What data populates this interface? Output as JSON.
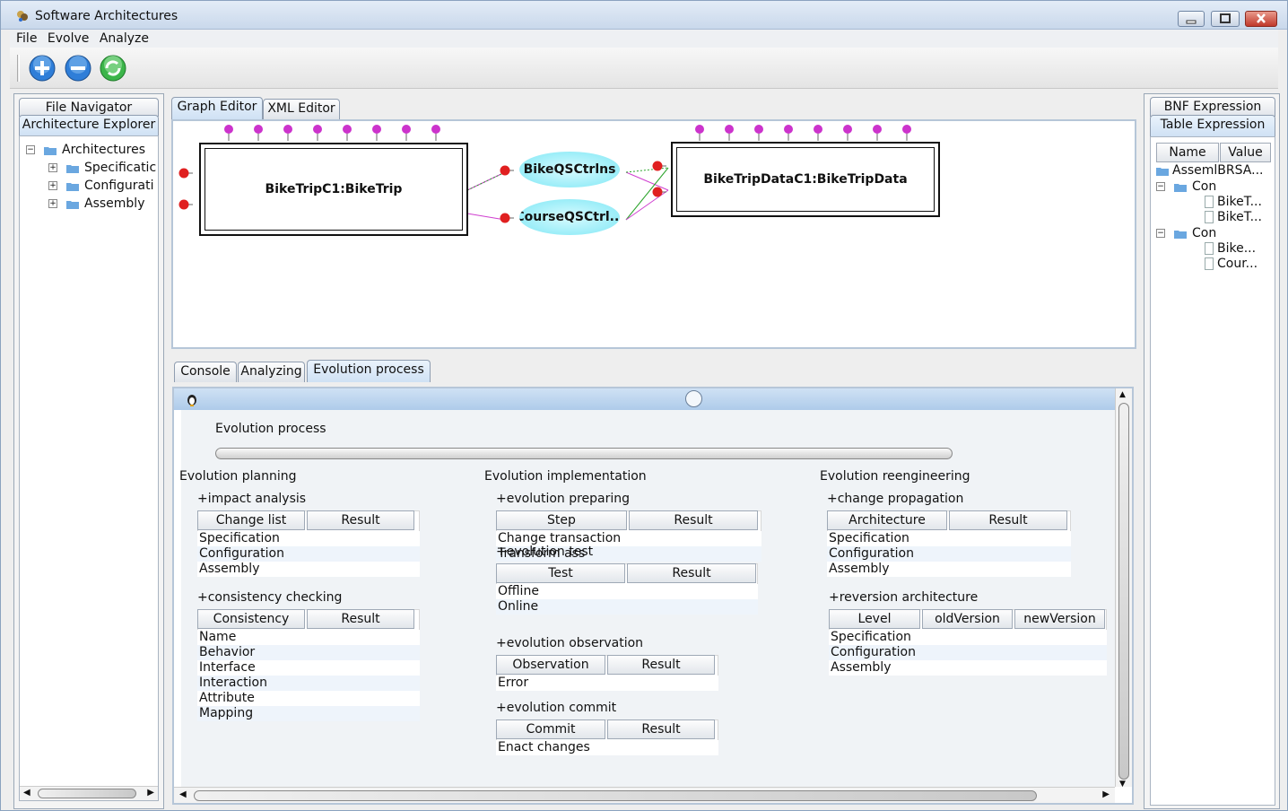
{
  "window": {
    "title": "Software Architectures"
  },
  "menu": {
    "items": [
      "File",
      "Evolve",
      "Analyze"
    ]
  },
  "left": {
    "tabs": [
      "File Navigator",
      "Architecture Explorer"
    ],
    "tree": {
      "root": "Architectures",
      "children": [
        "Specificatic",
        "Configurati",
        "Assembly"
      ]
    }
  },
  "editor": {
    "tabs": [
      "Graph Editor",
      "XML Editor"
    ],
    "components": [
      "BikeTripC1:BikeTrip",
      "BikeTripDataC1:BikeTripData"
    ],
    "connectors": [
      "BikeQSCtrlns",
      "CourseQSCtrl..."
    ]
  },
  "bottom": {
    "tabs": [
      "Console",
      "Analyzing",
      "Evolution process"
    ]
  },
  "evolution": {
    "title": "Evolution process",
    "planning": {
      "title": "Evolution planning",
      "impact": {
        "label": "+impact analysis",
        "headers": [
          "Change list",
          "Result"
        ],
        "rows": [
          "Specification",
          "Configuration",
          "Assembly"
        ]
      },
      "consistency": {
        "label": "+consistency checking",
        "headers": [
          "Consistency",
          "Result"
        ],
        "rows": [
          "Name",
          "Behavior",
          "Interface",
          "Interaction",
          "Attribute",
          "Mapping"
        ]
      }
    },
    "implementation": {
      "title": "Evolution implementation",
      "preparing": {
        "label": "+evolution preparing",
        "headers": [
          "Step",
          "Result"
        ],
        "rows": [
          "Change transaction",
          "Transform ass"
        ]
      },
      "test": {
        "label": "+evolution test",
        "headers": [
          "Test",
          "Result"
        ],
        "rows": [
          "Offline",
          "Online"
        ]
      },
      "observation": {
        "label": "+evolution observation",
        "headers": [
          "Observation",
          "Result"
        ],
        "rows": [
          "Error"
        ]
      },
      "commit": {
        "label": "+evolution commit",
        "headers": [
          "Commit",
          "Result"
        ],
        "rows": [
          "Enact changes"
        ]
      }
    },
    "reengineering": {
      "title": "Evolution reengineering",
      "propagation": {
        "label": "+change propagation",
        "headers": [
          "Architecture",
          "Result"
        ],
        "rows": [
          "Specification",
          "Configuration",
          "Assembly"
        ]
      },
      "reversion": {
        "label": "+reversion architecture",
        "headers": [
          "Level",
          "oldVersion",
          "newVersion"
        ],
        "rows": [
          "Specification",
          "Configuration",
          "Assembly"
        ]
      }
    }
  },
  "right": {
    "tabs": [
      "BNF Expression",
      "Table Expression"
    ],
    "headers": [
      "Name",
      "Value"
    ],
    "rows": [
      "AssemlBRSA...",
      "Con",
      "BikeT...",
      "BikeT...",
      "Con",
      "Bike...",
      "Cour..."
    ]
  },
  "colors": {
    "port_out": "#cc33cc",
    "port_in": "#e02020",
    "connector": "#8fe9f7",
    "accent": "#cfe1f4"
  }
}
